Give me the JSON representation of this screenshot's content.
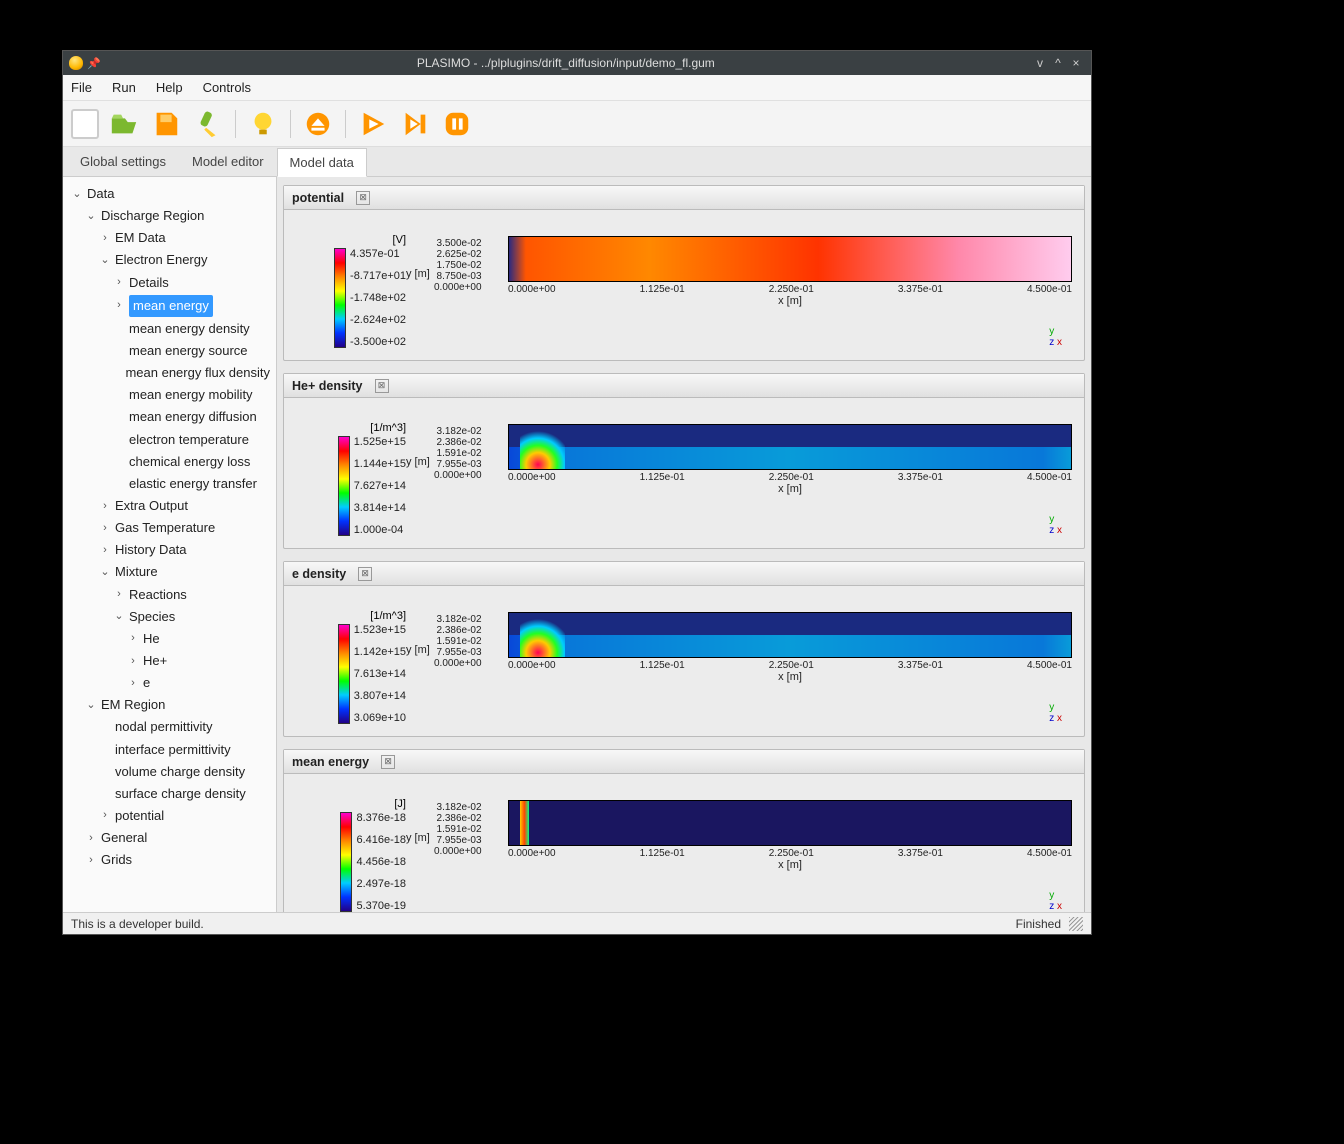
{
  "window": {
    "title": "PLASIMO - ../plplugins/drift_diffusion/input/demo_fl.gum"
  },
  "menu": {
    "file": "File",
    "run": "Run",
    "help": "Help",
    "controls": "Controls"
  },
  "tabs": {
    "global": "Global settings",
    "editor": "Model editor",
    "data": "Model data"
  },
  "tree": {
    "data": "Data",
    "discharge": "Discharge Region",
    "emdata": "EM Data",
    "ee": "Electron Energy",
    "details": "Details",
    "mean_energy": "mean energy",
    "me_density": "mean energy density",
    "me_source": "mean energy source",
    "me_flux": "mean energy flux density",
    "me_mobility": "mean energy mobility",
    "me_diffusion": "mean energy diffusion",
    "e_temp": "electron temperature",
    "chem_loss": "chemical energy loss",
    "elastic": "elastic energy transfer",
    "extra": "Extra Output",
    "gastemp": "Gas Temperature",
    "history": "History Data",
    "mixture": "Mixture",
    "reactions": "Reactions",
    "species": "Species",
    "he": "He",
    "hep": "He+",
    "e": "e",
    "emregion": "EM Region",
    "nodal": "nodal permittivity",
    "interface": "interface permittivity",
    "volcharge": "volume charge density",
    "surfcharge": "surface charge density",
    "potential": "potential",
    "general": "General",
    "grids": "Grids"
  },
  "plots": [
    {
      "title": "potential",
      "units": "[V]",
      "cb": [
        "4.357e-01",
        "-8.717e+01",
        "-1.748e+02",
        "-2.624e+02",
        "-3.500e+02"
      ],
      "yticks": [
        "3.500e-02",
        "2.625e-02",
        "1.750e-02",
        "8.750e-03",
        "0.000e+00"
      ],
      "ylabel": "y [m]",
      "xticks": [
        "0.000e+00",
        "1.125e-01",
        "2.250e-01",
        "3.375e-01",
        "4.500e-01"
      ],
      "xlabel": "x [m]"
    },
    {
      "title": "He+ density",
      "units": "[1/m^3]",
      "cb": [
        "1.525e+15",
        "1.144e+15",
        "7.627e+14",
        "3.814e+14",
        "1.000e-04"
      ],
      "yticks": [
        "3.182e-02",
        "2.386e-02",
        "1.591e-02",
        "7.955e-03",
        "0.000e+00"
      ],
      "ylabel": "y [m]",
      "xticks": [
        "0.000e+00",
        "1.125e-01",
        "2.250e-01",
        "3.375e-01",
        "4.500e-01"
      ],
      "xlabel": "x [m]"
    },
    {
      "title": "e density",
      "units": "[1/m^3]",
      "cb": [
        "1.523e+15",
        "1.142e+15",
        "7.613e+14",
        "3.807e+14",
        "3.069e+10"
      ],
      "yticks": [
        "3.182e-02",
        "2.386e-02",
        "1.591e-02",
        "7.955e-03",
        "0.000e+00"
      ],
      "ylabel": "y [m]",
      "xticks": [
        "0.000e+00",
        "1.125e-01",
        "2.250e-01",
        "3.375e-01",
        "4.500e-01"
      ],
      "xlabel": "x [m]"
    },
    {
      "title": "mean energy",
      "units": "[J]",
      "cb": [
        "8.376e-18",
        "6.416e-18",
        "4.456e-18",
        "2.497e-18",
        "5.370e-19"
      ],
      "yticks": [
        "3.182e-02",
        "2.386e-02",
        "1.591e-02",
        "7.955e-03",
        "0.000e+00"
      ],
      "ylabel": "y [m]",
      "xticks": [
        "0.000e+00",
        "1.125e-01",
        "2.250e-01",
        "3.375e-01",
        "4.500e-01"
      ],
      "xlabel": "x [m]"
    }
  ],
  "status": {
    "left": "This is a developer build.",
    "right": "Finished"
  },
  "chart_data": [
    {
      "type": "heatmap",
      "title": "potential",
      "units": "V",
      "xlabel": "x [m]",
      "ylabel": "y [m]",
      "xlim": [
        0.0,
        0.45
      ],
      "ylim": [
        0.0,
        0.035
      ],
      "value_range": [
        -350.0,
        0.4357
      ]
    },
    {
      "type": "heatmap",
      "title": "He+ density",
      "units": "1/m^3",
      "xlabel": "x [m]",
      "ylabel": "y [m]",
      "xlim": [
        0.0,
        0.45
      ],
      "ylim": [
        0.0,
        0.03182
      ],
      "value_range": [
        0.0001,
        1525000000000000.0
      ]
    },
    {
      "type": "heatmap",
      "title": "e density",
      "units": "1/m^3",
      "xlabel": "x [m]",
      "ylabel": "y [m]",
      "xlim": [
        0.0,
        0.45
      ],
      "ylim": [
        0.0,
        0.03182
      ],
      "value_range": [
        30690000000.0,
        1523000000000000.0
      ]
    },
    {
      "type": "heatmap",
      "title": "mean energy",
      "units": "J",
      "xlabel": "x [m]",
      "ylabel": "y [m]",
      "xlim": [
        0.0,
        0.45
      ],
      "ylim": [
        0.0,
        0.03182
      ],
      "value_range": [
        5.37e-19,
        8.376e-18
      ]
    }
  ]
}
